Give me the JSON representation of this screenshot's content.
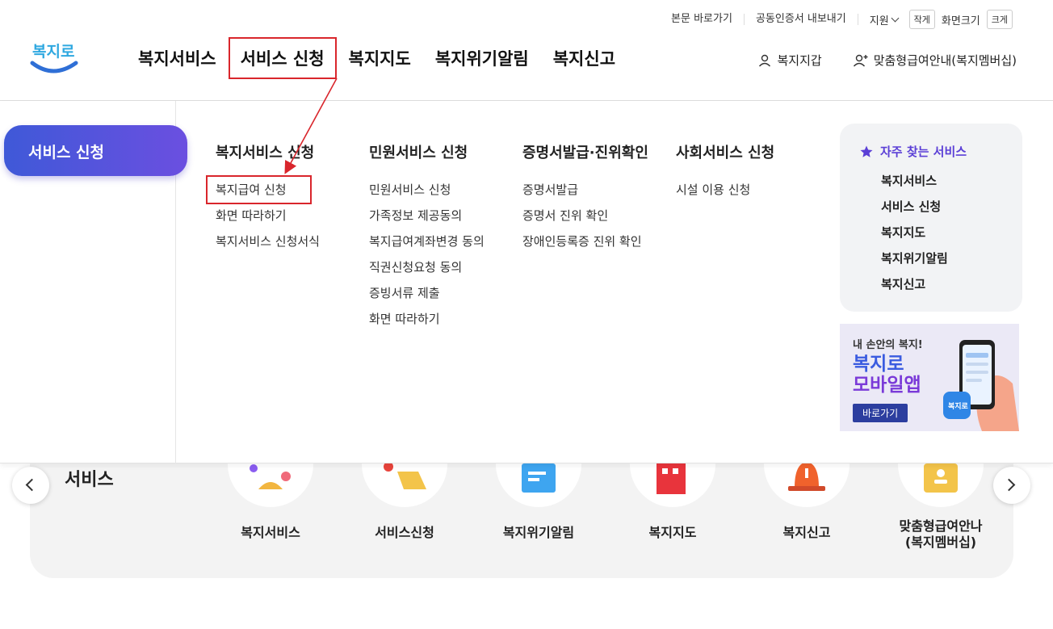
{
  "utility": {
    "skip_to_content": "본문 바로가기",
    "export_cert": "공동인증서 내보내기",
    "support": "지원",
    "small": "작게",
    "screen_size": "화면크기",
    "large": "크게"
  },
  "logo": {
    "text": "복지로"
  },
  "gnb": [
    {
      "label": "복지서비스"
    },
    {
      "label": "서비스 신청"
    },
    {
      "label": "복지지도"
    },
    {
      "label": "복지위기알림"
    },
    {
      "label": "복지신고"
    }
  ],
  "header_right": {
    "wallet": "복지지갑",
    "membership": "맞춤형급여안내(복지멤버십)"
  },
  "mega": {
    "side_tab": "서비스 신청",
    "columns": [
      {
        "title": "복지서비스 신청",
        "links": [
          "복지급여 신청",
          "화면 따라하기",
          "복지서비스 신청서식"
        ]
      },
      {
        "title": "민원서비스 신청",
        "links": [
          "민원서비스 신청",
          "가족정보 제공동의",
          "복지급여계좌변경 동의",
          "직권신청요청 동의",
          "증빙서류 제출",
          "화면 따라하기"
        ]
      },
      {
        "title": "증명서발급·진위확인",
        "links": [
          "증명서발급",
          "증명서 진위 확인",
          "장애인등록증 진위 확인"
        ]
      },
      {
        "title": "사회서비스 신청",
        "links": [
          "시설 이용 신청"
        ]
      }
    ],
    "favorites": {
      "title": "자주 찾는 서비스",
      "items": [
        "복지서비스",
        "서비스 신청",
        "복지지도",
        "복지위기알림",
        "복지신고"
      ]
    },
    "banner": {
      "line1": "내 손안의 복지!",
      "line2": "복지로",
      "line3": "모바일앱",
      "button": "바로가기",
      "app_icon": "복지로"
    }
  },
  "lower": {
    "title": "서비스",
    "items": [
      {
        "label": "복지서비스"
      },
      {
        "label": "서비스신청"
      },
      {
        "label": "복지위기알림"
      },
      {
        "label": "복지지도"
      },
      {
        "label": "복지신고"
      },
      {
        "label": "맞춤형급여안나",
        "label2": "(복지멤버십)"
      }
    ]
  },
  "colors": {
    "accent_red": "#d9262c",
    "brand_blue": "#3f59d8",
    "brand_purple": "#6b4fe0"
  }
}
